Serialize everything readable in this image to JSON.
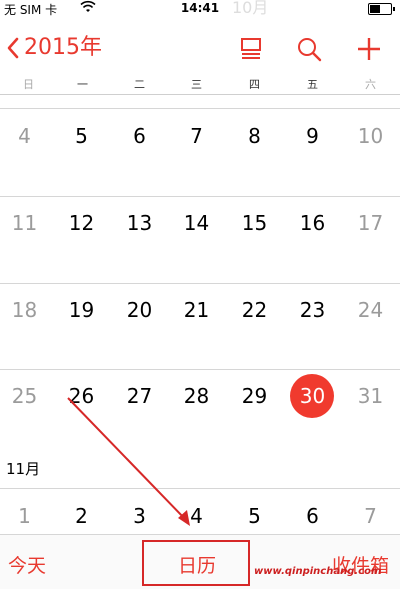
{
  "status_bar": {
    "carrier": "无 SIM 卡",
    "time": "14:41"
  },
  "header": {
    "ghost_month": "10月",
    "back_label": "2015年"
  },
  "icons": {
    "back": "chevron-left-icon",
    "list_view": "list-view-icon",
    "search": "search-icon",
    "add": "plus-icon"
  },
  "weekdays": [
    "日",
    "一",
    "二",
    "三",
    "四",
    "五",
    "六"
  ],
  "weeks": [
    [
      "4",
      "5",
      "6",
      "7",
      "8",
      "9",
      "10"
    ],
    [
      "11",
      "12",
      "13",
      "14",
      "15",
      "16",
      "17"
    ],
    [
      "18",
      "19",
      "20",
      "21",
      "22",
      "23",
      "24"
    ],
    [
      "25",
      "26",
      "27",
      "28",
      "29",
      "30",
      "31"
    ]
  ],
  "today": "30",
  "next_month": {
    "label": "11月",
    "days": [
      "1",
      "2",
      "3",
      "4",
      "5",
      "6",
      "7"
    ]
  },
  "tabbar": {
    "today": "今天",
    "calendars": "日历",
    "inbox": "收件箱"
  },
  "watermark": "www.qinpinchang.com",
  "colors": {
    "accent": "#e8392f",
    "today_circle": "#f03a2e",
    "weekend_text": "#9b9b9b",
    "annotation": "#d62828"
  }
}
